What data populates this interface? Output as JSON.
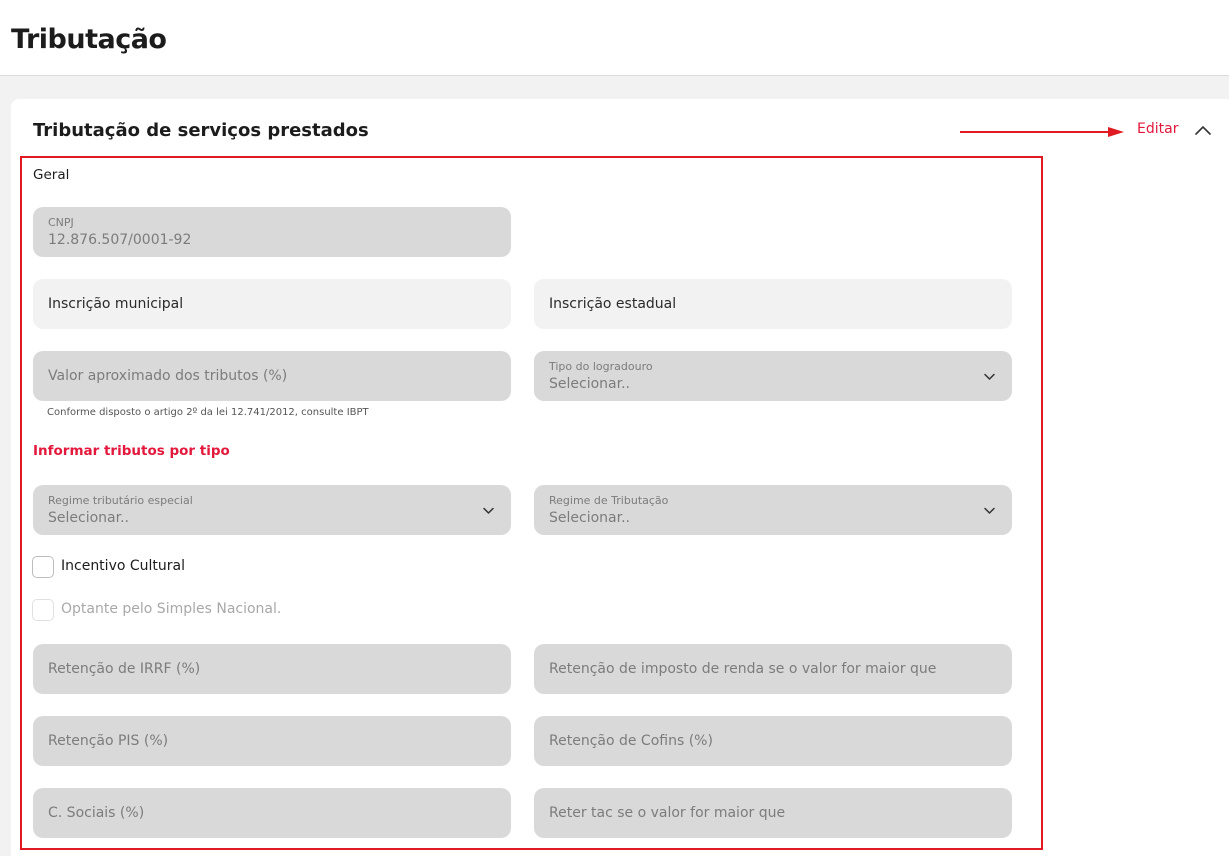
{
  "header": {
    "title": "Tributação"
  },
  "section": {
    "title": "Tributação de serviços prestados",
    "edit_label": "Editar",
    "collapse_icon": "chevron-up-icon"
  },
  "geral": {
    "heading": "Geral",
    "cnpj": {
      "label": "CNPJ",
      "value": "12.876.507/0001-92"
    },
    "inscricao_municipal": {
      "placeholder": "Inscrição municipal"
    },
    "inscricao_estadual": {
      "placeholder": "Inscrição estadual"
    },
    "valor_aproximado": {
      "placeholder": "Valor aproximado dos tributos (%)"
    },
    "helper_text": "Conforme disposto o artigo 2º da lei 12.741/2012, consulte IBPT",
    "tipo_logradouro": {
      "label": "Tipo do logradouro",
      "value": "Selecionar..",
      "icon": "chevron-down-icon"
    }
  },
  "tributos": {
    "link": "Informar tributos por tipo",
    "regime_especial": {
      "label": "Regime tributário especial",
      "value": "Selecionar.."
    },
    "regime_tributacao": {
      "label": "Regime de Tributação",
      "value": "Selecionar.."
    },
    "incentivo_cultural": {
      "label": "Incentivo Cultural",
      "checked": false
    },
    "simples_nacional": {
      "label": "Optante pelo Simples Nacional.",
      "checked": false,
      "disabled": true
    },
    "retencao_irrf": {
      "placeholder": "Retenção de IRRF (%)"
    },
    "retencao_ir_maior": {
      "placeholder": "Retenção de imposto de renda se o valor for maior que"
    },
    "retencao_pis": {
      "placeholder": "Retenção PIS (%)"
    },
    "retencao_cofins": {
      "placeholder": "Retenção de Cofins (%)"
    },
    "c_sociais": {
      "placeholder": "C. Sociais (%)"
    },
    "reter_tac": {
      "placeholder": "Reter tac se o valor for maior que"
    }
  },
  "colors": {
    "accent": "#e3183c",
    "annotation": "#e01a22",
    "field_disabled": "#d9d9d9",
    "field_enabled": "#f2f2f2"
  }
}
